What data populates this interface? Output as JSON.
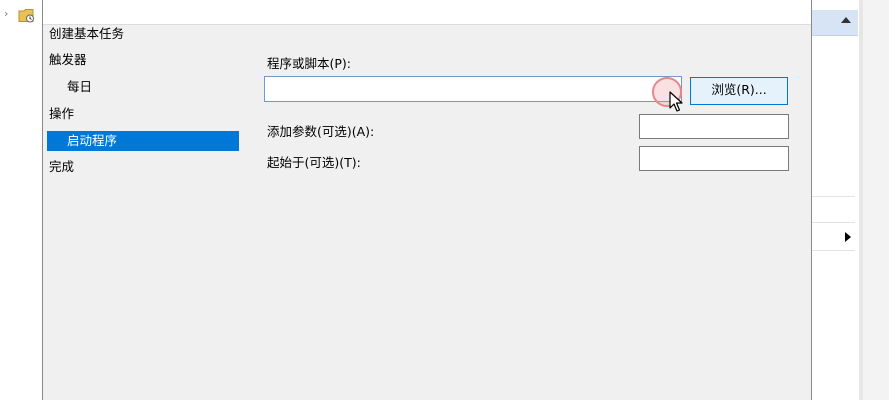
{
  "wizard": {
    "steps": [
      {
        "label": "创建基本任务"
      },
      {
        "label": "触发器"
      },
      {
        "label": "每日"
      },
      {
        "label": "操作"
      },
      {
        "label": "启动程序"
      },
      {
        "label": "完成"
      }
    ]
  },
  "form": {
    "program": {
      "label": "程序或脚本(P):",
      "value": ""
    },
    "browse_button": "浏览(R)...",
    "arguments": {
      "label": "添加参数(可选)(A):",
      "value": ""
    },
    "start_in": {
      "label": "起始于(可选)(T):",
      "value": ""
    }
  },
  "icons": {
    "tree_expand": "chevron-right-icon",
    "tree_node": "task-folder-icon",
    "actions_collapse": "triangle-up-icon",
    "submenu": "triangle-right-icon",
    "cursor": "mouse-pointer-icon"
  },
  "colors": {
    "selection": "#0078d7",
    "button_bg": "#e5f1fb",
    "dialog_bg": "#f0f0f0",
    "click_highlight": "#e8868c"
  }
}
